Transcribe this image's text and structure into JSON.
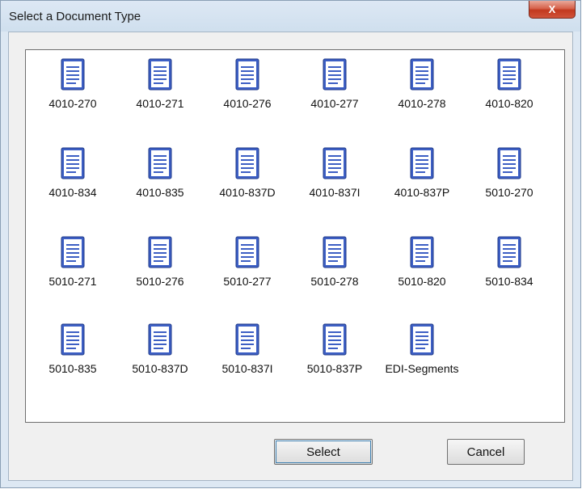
{
  "window": {
    "title": "Select a Document Type",
    "close_glyph": "X"
  },
  "document_types": [
    {
      "label": "4010-270",
      "icon": "document-icon"
    },
    {
      "label": "4010-271",
      "icon": "document-icon"
    },
    {
      "label": "4010-276",
      "icon": "document-icon"
    },
    {
      "label": "4010-277",
      "icon": "document-icon"
    },
    {
      "label": "4010-278",
      "icon": "document-icon"
    },
    {
      "label": "4010-820",
      "icon": "document-icon"
    },
    {
      "label": "4010-834",
      "icon": "document-icon"
    },
    {
      "label": "4010-835",
      "icon": "document-icon"
    },
    {
      "label": "4010-837D",
      "icon": "document-icon"
    },
    {
      "label": "4010-837I",
      "icon": "document-icon"
    },
    {
      "label": "4010-837P",
      "icon": "document-icon"
    },
    {
      "label": "5010-270",
      "icon": "document-icon"
    },
    {
      "label": "5010-271",
      "icon": "document-icon"
    },
    {
      "label": "5010-276",
      "icon": "document-icon"
    },
    {
      "label": "5010-277",
      "icon": "document-icon"
    },
    {
      "label": "5010-278",
      "icon": "document-icon"
    },
    {
      "label": "5010-820",
      "icon": "document-icon"
    },
    {
      "label": "5010-834",
      "icon": "document-icon"
    },
    {
      "label": "5010-835",
      "icon": "document-icon"
    },
    {
      "label": "5010-837D",
      "icon": "document-icon"
    },
    {
      "label": "5010-837I",
      "icon": "document-icon"
    },
    {
      "label": "5010-837P",
      "icon": "document-icon"
    },
    {
      "label": "EDI-Segments",
      "icon": "document-icon"
    }
  ],
  "buttons": {
    "select_label": "Select",
    "cancel_label": "Cancel"
  },
  "colors": {
    "icon_fill": "#3d5fc4",
    "icon_page": "#ffffff",
    "close_button": "#c7432b"
  }
}
